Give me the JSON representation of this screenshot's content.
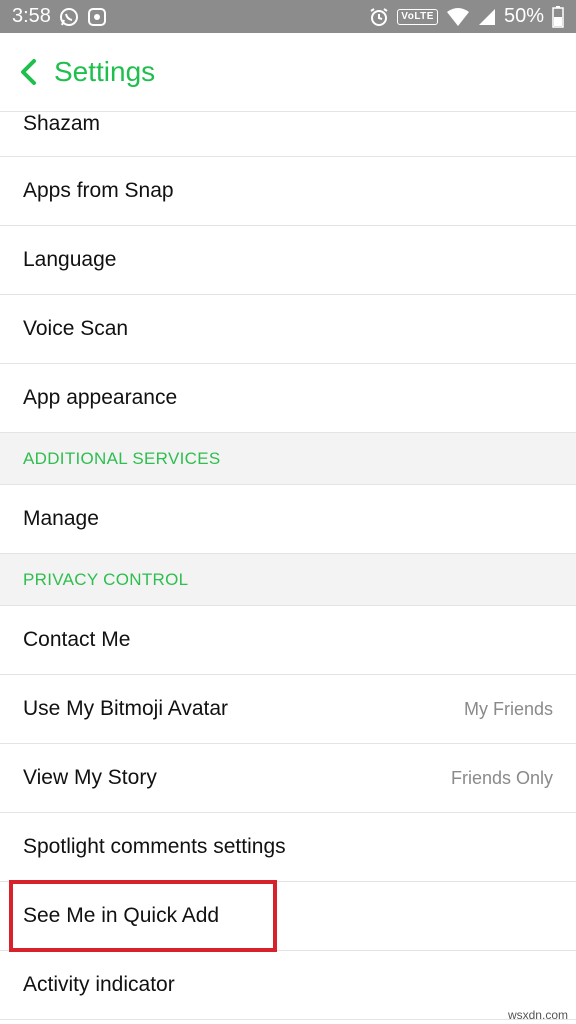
{
  "status_bar": {
    "time": "3:58",
    "network_badge": "VoLTE",
    "battery": "50%",
    "icons": [
      "whatsapp-icon",
      "app-notification-icon",
      "alarm-icon",
      "wifi-icon",
      "signal-icon",
      "battery-icon"
    ]
  },
  "header": {
    "back_icon": "chevron-left-icon",
    "title": "Settings",
    "accent_color": "#1fbf4e"
  },
  "items": {
    "shazam": "Shazam",
    "apps_from_snap": "Apps from Snap",
    "language": "Language",
    "voice_scan": "Voice Scan",
    "app_appearance": "App appearance",
    "additional_services_header": "ADDITIONAL SERVICES",
    "manage": "Manage",
    "privacy_control_header": "PRIVACY CONTROL",
    "contact_me": "Contact Me",
    "use_my_bitmoji_avatar": "Use My Bitmoji Avatar",
    "use_my_bitmoji_avatar_value": "My Friends",
    "view_my_story": "View My Story",
    "view_my_story_value": "Friends Only",
    "spotlight_comments_settings": "Spotlight comments settings",
    "see_me_in_quick_add": "See Me in Quick Add",
    "activity_indicator": "Activity indicator"
  },
  "annotation": {
    "highlight_color": "#d7222b",
    "highlighted_item": "See Me in Quick Add"
  },
  "watermark": "wsxdn.com"
}
